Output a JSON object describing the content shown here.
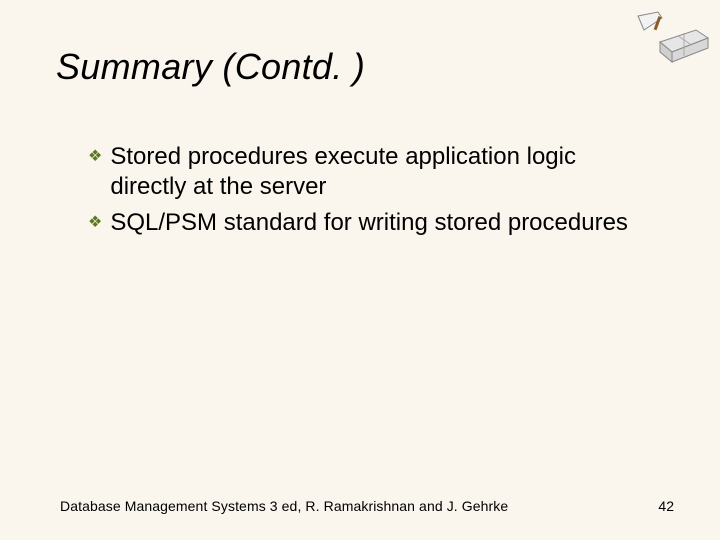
{
  "title": "Summary (Contd. )",
  "bullets": [
    "Stored procedures execute application logic directly at the server",
    "SQL/PSM standard for writing stored procedures"
  ],
  "footer": "Database Management Systems 3 ed,  R. Ramakrishnan and J. Gehrke",
  "page_number": "42"
}
